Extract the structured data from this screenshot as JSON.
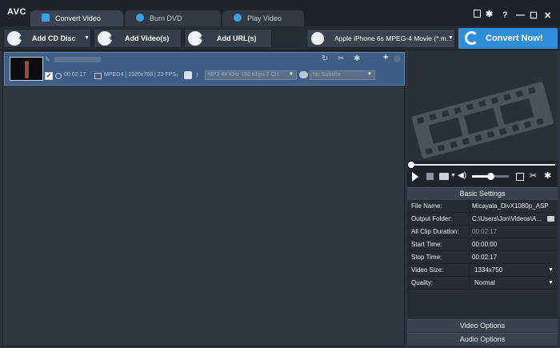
{
  "app": {
    "logo": "AVC"
  },
  "tabs": [
    {
      "label": "Convert Video",
      "active": true
    },
    {
      "label": "Burn DVD",
      "active": false
    },
    {
      "label": "Play Video",
      "active": false
    }
  ],
  "window_controls": {
    "help": "?",
    "minimize": "—",
    "maximize": "☐",
    "close": "✕"
  },
  "toolbar": {
    "add_cd_disc": "Add CD Disc",
    "add_videos": "Add Video(s)",
    "add_url": "Add URL(s)",
    "profile": "Apple iPhone 6s MPEG-4 Movie (*.m...",
    "convert_now": "Convert Now!"
  },
  "file_item": {
    "duration": "00:02:17",
    "video_info": "MPEG4 | 1920x768 | 23 FPS",
    "audio_track": "MP3 44 KHz 192 Kbps 2 CH",
    "subtitle": "No Subtitle"
  },
  "settings": {
    "basic_header": "Basic Settings",
    "rows": [
      {
        "key": "File Name:",
        "value": "Micayala_DivX1080p_ASP"
      },
      {
        "key": "Output Folder:",
        "value": "C:\\Users\\Jon\\Videos\\A..."
      },
      {
        "key": "All Clip Duration:",
        "value": "00:02:17"
      },
      {
        "key": "Start Time:",
        "value": "00:00:00"
      },
      {
        "key": "Stop Time:",
        "value": "00:02:17"
      },
      {
        "key": "Video Size:",
        "value": "1334x750"
      },
      {
        "key": "Quality:",
        "value": "Normal"
      }
    ],
    "video_options": "Video Options",
    "audio_options": "Audio Options"
  },
  "player": {
    "volume": 0.5
  },
  "colors": {
    "accent": "#2e8fd8",
    "selected_row": "#3d5f86"
  }
}
